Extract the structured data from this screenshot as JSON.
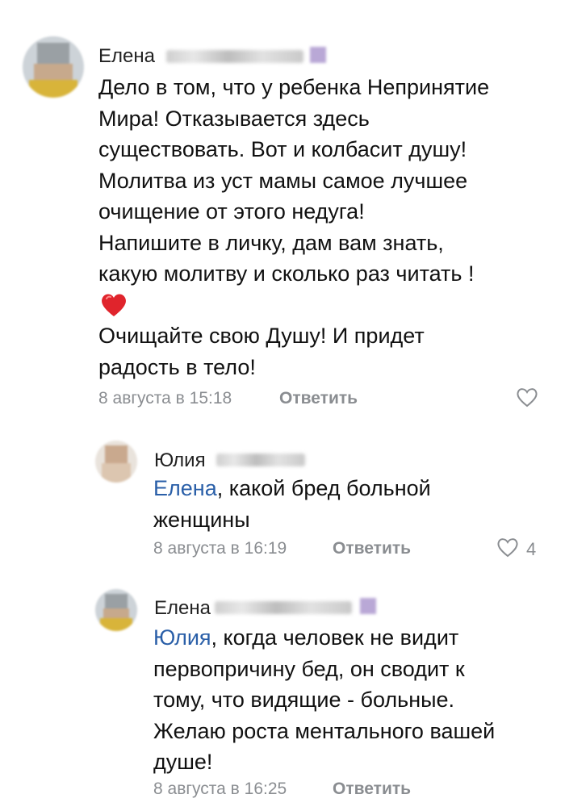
{
  "comments": [
    {
      "author": "Елена",
      "lines": [
        "Дело в том, что у ребенка Непринятие",
        "Мира! Отказывается здесь",
        "существовать. Вот и колбасит душу!",
        "Молитва из уст мамы самое лучшее",
        "очищение от этого недуга!",
        "Напишите в личку, дам вам знать,",
        "какую молитву и сколько раз читать !"
      ],
      "emoji": "red-heart",
      "lines_after": [
        "Очищайте свою Душу! И придет",
        "радость в тело!"
      ],
      "date": "8 августа в 15:18",
      "reply_label": "Ответить",
      "likes": ""
    },
    {
      "author": "Юлия",
      "mention": "Елена",
      "lines": [
        ", какой бред больной",
        "женщины"
      ],
      "date": "8 августа в 16:19",
      "reply_label": "Ответить",
      "likes": "4"
    },
    {
      "author": "Елена",
      "mention": "Юлия",
      "lines": [
        ", когда человек не видит",
        "первопричину бед, он сводит к",
        "тому, что видящие - больные.",
        "Желаю роста ментального вашей",
        "душе!"
      ],
      "date": "8 августа в 16:25",
      "reply_label": "Ответить",
      "likes": ""
    }
  ],
  "icons": {
    "like": "heart-outline-icon",
    "emoji": "red-heart"
  },
  "colors": {
    "mention": "#2a5fa8",
    "meta": "#8a8d91",
    "emoji_heart": "#e0242c"
  }
}
